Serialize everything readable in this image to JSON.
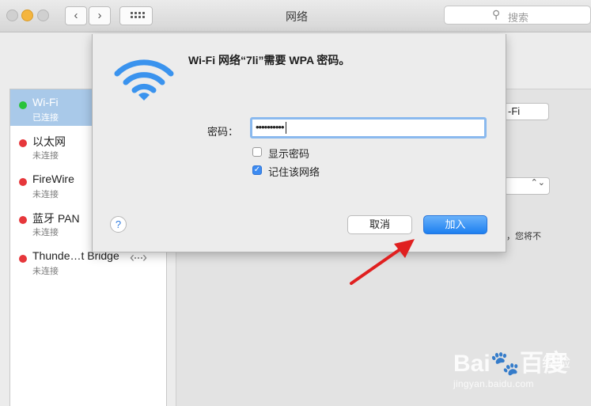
{
  "window": {
    "title": "网络"
  },
  "toolbar": {
    "back_glyph": "‹",
    "forward_glyph": "›",
    "search_icon_glyph": "⚲",
    "search_placeholder": "搜索"
  },
  "services": [
    {
      "name": "Wi-Fi",
      "status": "已连接",
      "state_color": "#29c33a",
      "selected": true
    },
    {
      "name": "以太网",
      "status": "未连接",
      "state_color": "#e6373b"
    },
    {
      "name": "FireWire",
      "status": "未连接",
      "state_color": "#e6373b"
    },
    {
      "name": "蓝牙 PAN",
      "status": "未连接",
      "state_color": "#e6373b"
    },
    {
      "name": "Thunde…t Bridge",
      "status": "未连接",
      "state_color": "#e6373b",
      "icon": "thunderbolt-bridge-icon",
      "icon_glyph": "‹···›"
    }
  ],
  "pane": {
    "button_label": "-Fi",
    "select_arrows": "⌃⌄",
    "text_fragment": "，您将不"
  },
  "dialog": {
    "icon": "wifi-icon",
    "title": "Wi-Fi 网络“7li”需要 WPA 密码。",
    "password_label": "密码：",
    "password_value": "••••••••••",
    "show_password_label": "显示密码",
    "show_password_checked": false,
    "remember_label": "记住该网络",
    "remember_checked": true,
    "checkmark_glyph": "✓",
    "help_glyph": "?",
    "cancel_label": "取消",
    "join_label": "加入"
  },
  "annotation": {
    "arrow_color": "#e02020"
  },
  "watermark": {
    "brand": "Bai🐾百度",
    "jingyan": "经验",
    "url": "jingyan.baidu.com"
  },
  "colors": {
    "accent": "#1c7ff0",
    "selection": "#a9c9e9"
  }
}
